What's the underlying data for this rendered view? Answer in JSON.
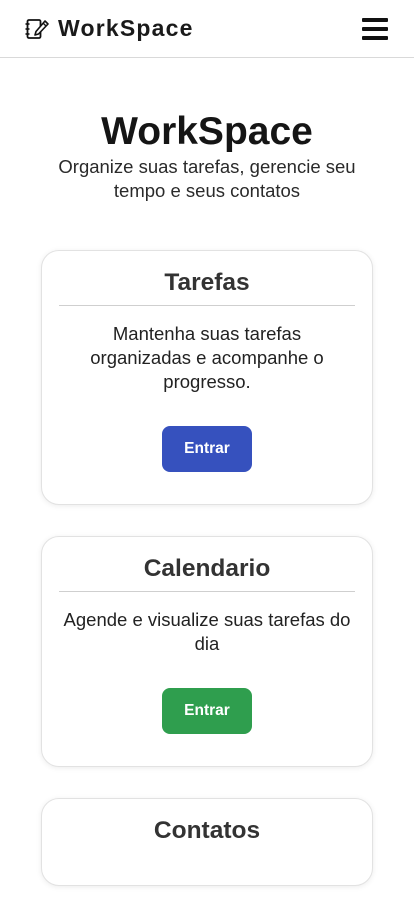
{
  "navbar": {
    "brand_icon": "notebook-pen-icon",
    "brand_name": "WorkSpace",
    "menu_icon": "hamburger-menu-icon"
  },
  "hero": {
    "title": "WorkSpace",
    "subtitle": "Organize suas tarefas, gerencie seu tempo e seus contatos"
  },
  "cards": [
    {
      "title": "Tarefas",
      "description": "Mantenha suas tarefas organizadas e acompanhe o progresso.",
      "button_label": "Entrar",
      "button_color": "#3651be"
    },
    {
      "title": "Calendario",
      "description": "Agende e visualize suas tarefas do dia",
      "button_label": "Entrar",
      "button_color": "#2f9e4e"
    },
    {
      "title": "Contatos"
    }
  ]
}
